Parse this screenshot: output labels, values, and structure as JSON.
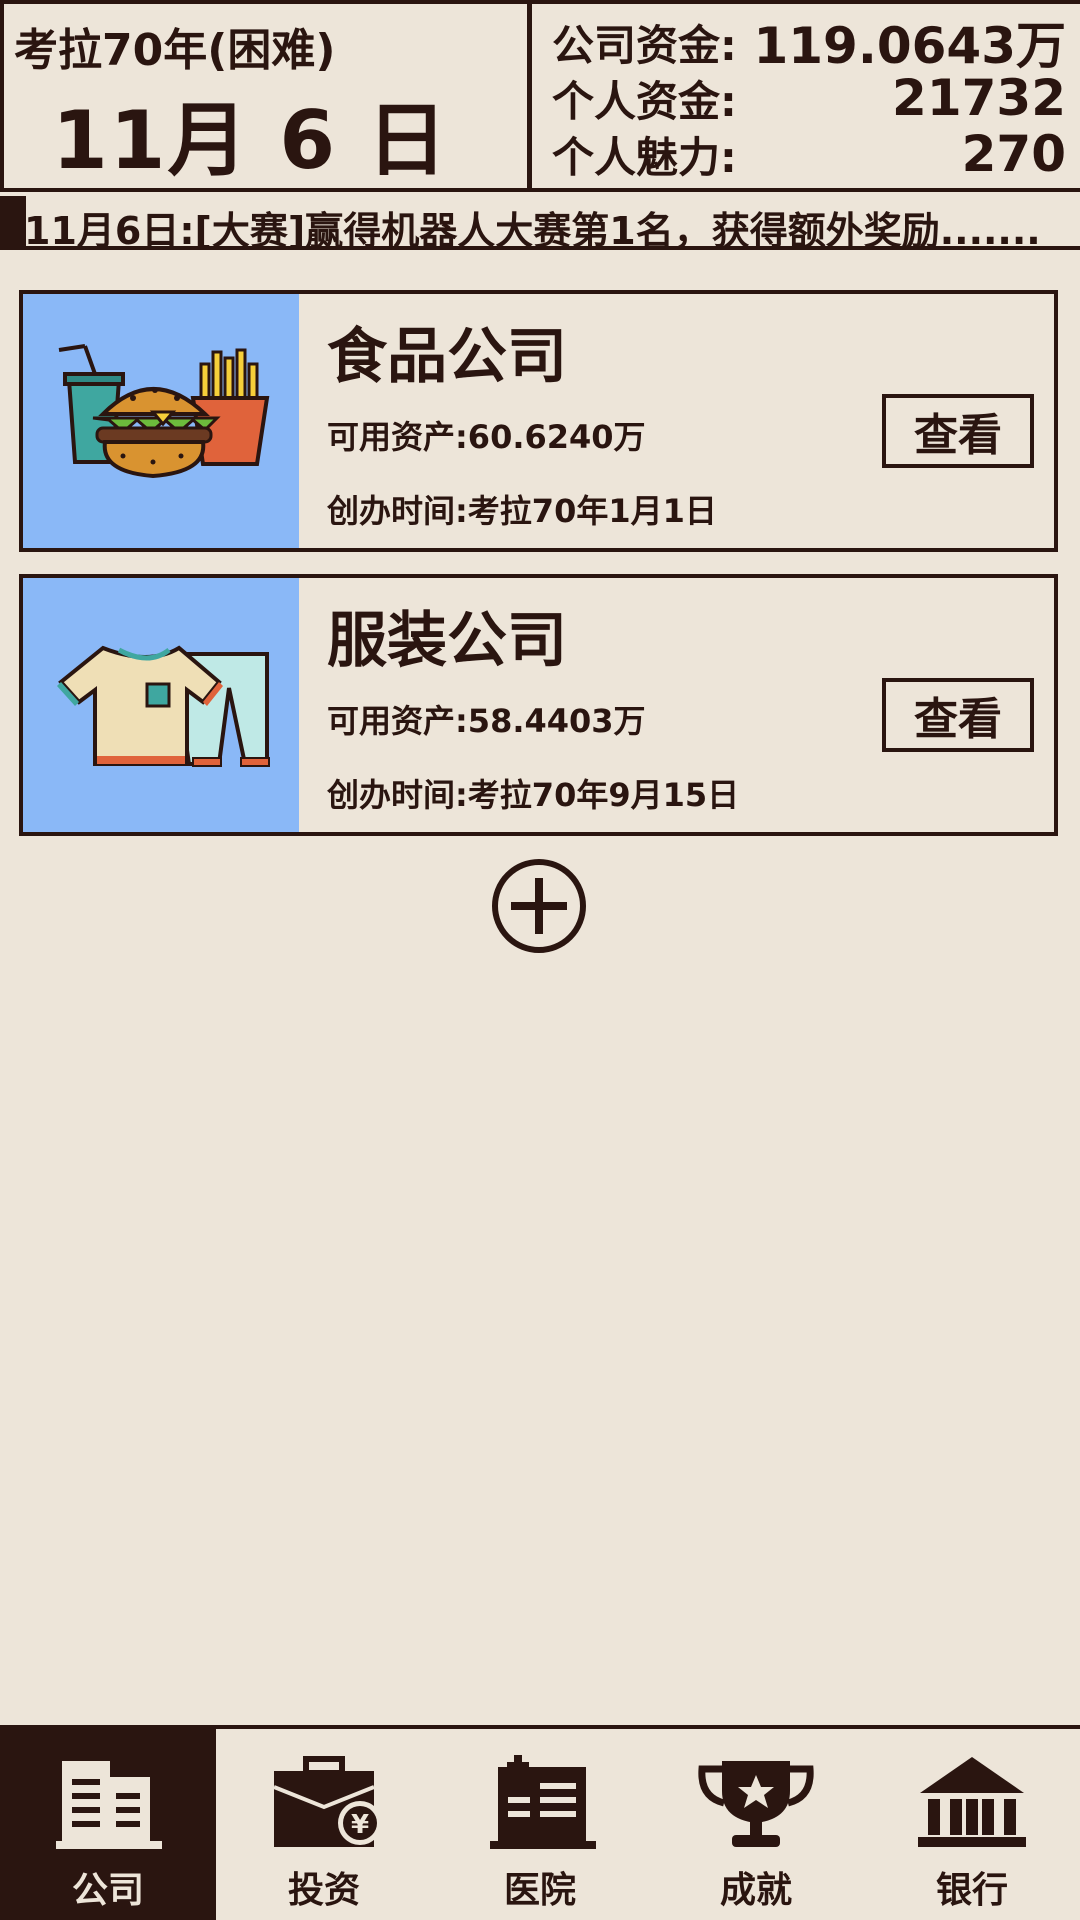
{
  "header": {
    "year_label": "考拉70年(困难)",
    "day_label": "11月 6 日",
    "stats": [
      {
        "label": "公司资金:",
        "value": "119.0643万"
      },
      {
        "label": "个人资金:",
        "value": "21732"
      },
      {
        "label": "个人魅力:",
        "value": "270"
      }
    ]
  },
  "ticker": {
    "text": "11月6日:[大赛]赢得机器人大赛第1名，获得额外奖励......."
  },
  "companies": [
    {
      "name": "食品公司",
      "assets": "可用资产:60.6240万",
      "founded": "创办时间:考拉70年1月1日",
      "view_label": "查看",
      "icon": "food-icon"
    },
    {
      "name": "服装公司",
      "assets": "可用资产:58.4403万",
      "founded": "创办时间:考拉70年9月15日",
      "view_label": "查看",
      "icon": "clothing-icon"
    }
  ],
  "add_button": {
    "icon": "plus-circle-icon"
  },
  "nav": {
    "active": "公司",
    "items": [
      {
        "label": "公司",
        "icon": "office-building-icon"
      },
      {
        "label": "投资",
        "icon": "briefcase-yen-icon"
      },
      {
        "label": "医院",
        "icon": "hospital-icon"
      },
      {
        "label": "成就",
        "icon": "trophy-icon"
      },
      {
        "label": "银行",
        "icon": "bank-icon"
      }
    ]
  },
  "colors": {
    "background": "#ede5d9",
    "ink": "#2a1510",
    "card_image_bg": "#8ab8f7"
  }
}
